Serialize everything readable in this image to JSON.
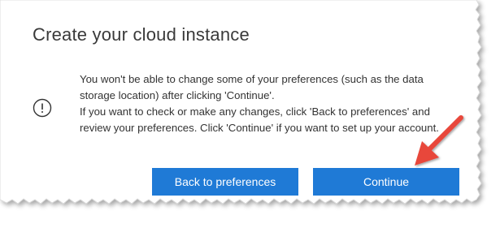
{
  "dialog": {
    "title": "Create your cloud instance",
    "message_lines": [
      "You won't be able to change some of your preferences (such as the data storage location) after clicking 'Continue'.",
      "If you want to check or make any changes, click 'Back to preferences' and review your preferences. Click 'Continue' if you want to set up your account."
    ],
    "back_button_label": "Back to preferences",
    "continue_button_label": "Continue"
  },
  "colors": {
    "button_blue": "#1f7ad6",
    "arrow_red": "#e8463a",
    "title_text": "#3a3a3a"
  },
  "icons": {
    "info": "info-circle-icon",
    "annotation": "red-arrow-icon"
  }
}
